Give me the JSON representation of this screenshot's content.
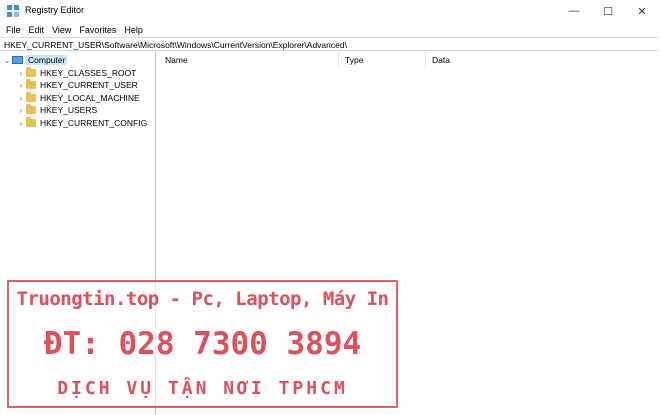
{
  "window": {
    "title": "Registry Editor",
    "minimize_glyph": "—",
    "maximize_glyph": "☐",
    "close_glyph": "✕"
  },
  "menu": [
    "File",
    "Edit",
    "View",
    "Favorites",
    "Help"
  ],
  "address": "HKEY_CURRENT_USER\\Software\\Microsoft\\Windows\\CurrentVersion\\Explorer\\Advanced\\",
  "tree": {
    "root": "Computer",
    "children": [
      "HKEY_CLASSES_ROOT",
      "HKEY_CURRENT_USER",
      "HKEY_LOCAL_MACHINE",
      "HKEY_USERS",
      "HKEY_CURRENT_CONFIG"
    ]
  },
  "columns": [
    "Name",
    "Type",
    "Data"
  ],
  "watermark": {
    "line1": "Truongtin.top - Pc, Laptop, Máy In",
    "line2": "ĐT: 028 7300 3894",
    "line3": "DỊCH VỤ TẬN NƠI TPHCM"
  },
  "colors": {
    "folder": "#e8c055",
    "selection": "#cce4f7",
    "watermark": "#e0505a"
  },
  "icons": {
    "app": "registry-editor-icon",
    "root": "computer-icon",
    "folder": "folder-icon",
    "chevron": "chevron-right-icon"
  }
}
